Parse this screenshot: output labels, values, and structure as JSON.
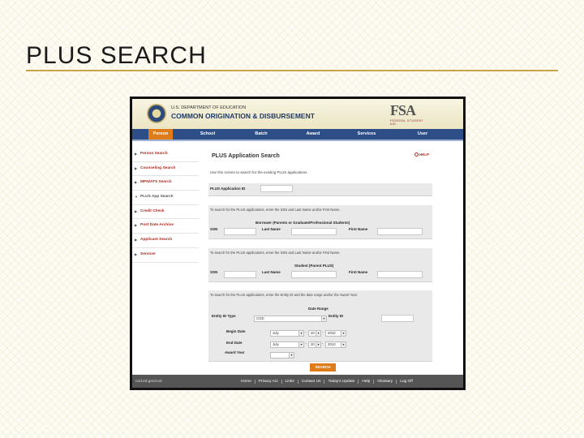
{
  "slide": {
    "title": "PLUS SEARCH"
  },
  "header": {
    "department": "U.S. DEPARTMENT OF EDUCATION",
    "system": "COMMON ORIGINATION & DISBURSEMENT",
    "fsa_logo": "FSA",
    "fsa_sub": "FEDERAL STUDENT AID"
  },
  "nav": {
    "items": [
      "Person",
      "School",
      "Batch",
      "Award",
      "Services",
      "User"
    ],
    "active": "Person",
    "active_color": "#e07b1a",
    "bar_color": "#2d4e86"
  },
  "sidebar": {
    "items": [
      "Person Search",
      "Counseling Search",
      "MPN/ATS Search",
      "PLUS App Search",
      "Credit Check",
      "Post Date Archive",
      "Applicant Search",
      "Servicer"
    ],
    "link_color": "#b0281e"
  },
  "main": {
    "heading": "PLUS Application Search",
    "help": "HELP",
    "intro": "Use this screen to search for the existing PLUS applications.",
    "app_id_label": "PLUS Application ID",
    "borrower": {
      "instructions": "To search for the PLUS applications, enter the SSN and Last Name and/or First Name.",
      "heading": "Borrower (Parents or Graduate/Professional Students)",
      "ssn_label": "SSN",
      "last_name_label": "Last Name",
      "first_name_label": "First Name"
    },
    "student": {
      "instructions": "To search for the PLUS applications, enter the SSN and Last Name and/or First Name.",
      "heading": "Student (Parent PLUS)",
      "ssn_label": "SSN",
      "last_name_label": "Last Name",
      "first_name_label": "First Name"
    },
    "entity": {
      "instructions": "To search for the PLUS applications, enter the Entity ID and the date range and/or the Award Year.",
      "date_range_label": "Date Range",
      "entity_type_label": "Entity ID Type",
      "entity_type_value": "COD",
      "entity_id_label": "Entity ID",
      "begin_label": "Begin Date",
      "end_label": "End Date",
      "award_year_label": "Award Year",
      "begin_month": "July",
      "begin_day": "20",
      "begin_year": "2010",
      "end_month": "July",
      "end_day": "20",
      "end_year": "2010",
      "dash": "-"
    },
    "search_button": "SEARCH"
  },
  "footer": {
    "brand": "cod.ed.gov/cod",
    "links": [
      "Home",
      "Privacy Act",
      "Links",
      "Contact Us",
      "Today's Update",
      "Help",
      "Glossary",
      "Log Off"
    ]
  }
}
